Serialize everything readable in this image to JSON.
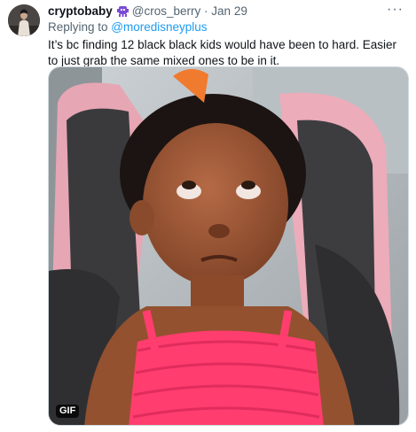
{
  "tweet": {
    "display_name": "cryptobaby",
    "badge_icon": "alien-monster-icon",
    "handle": "@cros_berry",
    "separator": "·",
    "date": "Jan 29",
    "more_icon": "···",
    "replying_prefix": "Replying to ",
    "replying_handle": "@moredisneyplus",
    "text": "It’s bc finding 12 black black kids would have been to hard. Easier to just grab the same mixed ones to be in it.",
    "media_type_label": "GIF"
  },
  "colors": {
    "link": "#1d9bf0",
    "secondary_text": "#536471",
    "badge": "#7b4bd6"
  }
}
